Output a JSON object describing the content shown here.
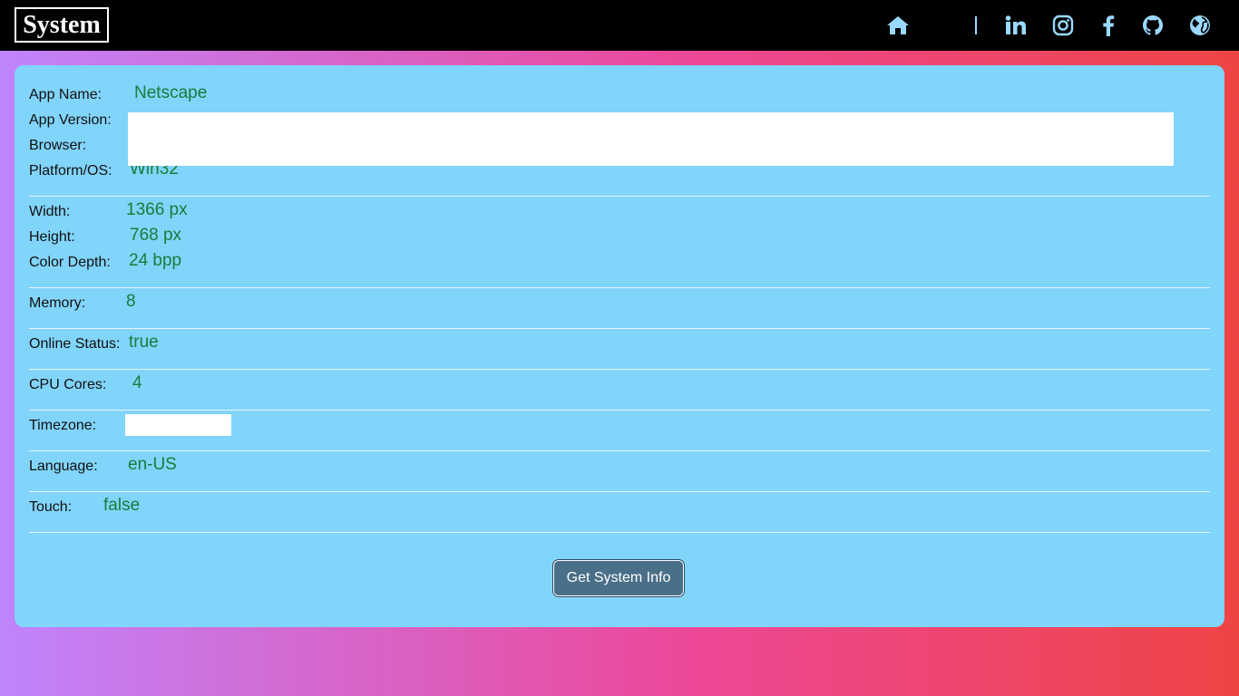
{
  "header": {
    "brand": "System",
    "icons": [
      "home-icon",
      "linkedin-icon",
      "instagram-icon",
      "facebook-icon",
      "github-icon",
      "globe-icon"
    ],
    "separator": "|"
  },
  "info": {
    "app_name": {
      "label": "App Name:",
      "value": "Netscape"
    },
    "app_version": {
      "label": "App Version:",
      "value": ""
    },
    "browser": {
      "label": "Browser:",
      "value": ""
    },
    "platform": {
      "label": "Platform/OS:",
      "value": "Win32"
    },
    "width": {
      "label": "Width:",
      "value": "1366 px"
    },
    "height": {
      "label": "Height:",
      "value": "768 px"
    },
    "color_depth": {
      "label": "Color Depth:",
      "value": "24 bpp"
    },
    "memory": {
      "label": "Memory:",
      "value": "8"
    },
    "online": {
      "label": "Online Status:",
      "value": "true"
    },
    "cpu": {
      "label": "CPU Cores:",
      "value": "4"
    },
    "timezone": {
      "label": "Timezone:",
      "value": ""
    },
    "language": {
      "label": "Language:",
      "value": "en-US"
    },
    "touch": {
      "label": "Touch:",
      "value": "false"
    }
  },
  "button": {
    "label": "Get System Info"
  },
  "colors": {
    "navbar": "#000000",
    "card": "#81d4fa",
    "value_text": "#1b7a3d",
    "button": "#4a6f88",
    "icon": "#9ad9ff"
  }
}
